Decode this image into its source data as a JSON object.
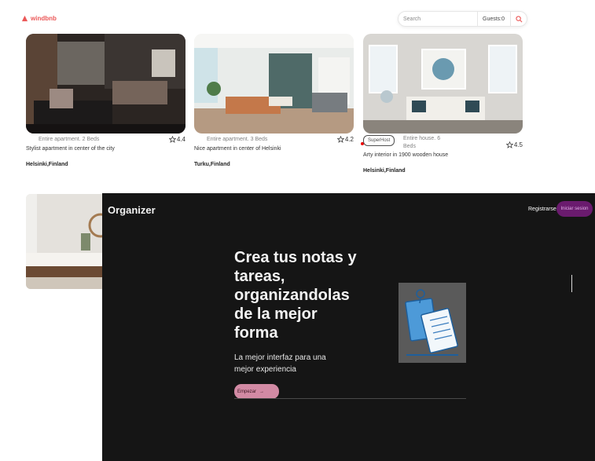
{
  "windbnb": {
    "logo_text": "windbnb",
    "search": {
      "placeholder": "Search",
      "guests_label": "Guests:0"
    },
    "stays": [
      {
        "type": "Entire apartment. 2 Beds",
        "rating": "4.4",
        "title": "Stylist apartment in center of the city",
        "location": "Helsinki,Finland"
      },
      {
        "type": "Entire apartment. 3 Beds",
        "rating": "4.2",
        "title": "Nice apartment in center of Helsinki",
        "location": "Turku,Finland"
      },
      {
        "superhost": "SuperHost",
        "type_line1": "Entire house. 6",
        "type_line2": "Beds",
        "rating": "4.5",
        "title": "Arty interior in 1900 wooden house",
        "location": "Helsinki,Finland"
      }
    ]
  },
  "organizer": {
    "brand": "Organizer",
    "register": "Registrarse",
    "login": "Iniciar sesion",
    "hero_title": "Crea tus notas y tareas, organizandolas de la mejor forma",
    "hero_subtitle": "La mejor interfaz para una mejor experiencia",
    "cta": "Empezar",
    "cta_arrow": "→"
  },
  "colors": {
    "brand_red": "#eb5757",
    "organizer_bg": "#151515",
    "cta_pink": "#d28aa4",
    "login_purple": "#6a1b6e"
  }
}
